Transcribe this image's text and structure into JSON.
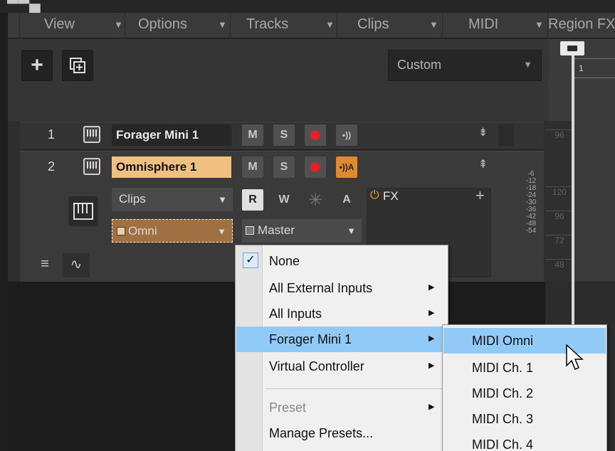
{
  "menubar": {
    "items": [
      {
        "label": "View"
      },
      {
        "label": "Options"
      },
      {
        "label": "Tracks"
      },
      {
        "label": "Clips"
      },
      {
        "label": "MIDI"
      },
      {
        "label": "Region FX"
      }
    ]
  },
  "toolbar": {
    "add_track_glyph": "+",
    "preset_select_value": "Custom"
  },
  "ruler": {
    "bar_number": "1"
  },
  "tracks": [
    {
      "number": "1",
      "name": "Forager Mini 1",
      "mute": "M",
      "solo": "S"
    },
    {
      "number": "2",
      "name": "Omnisphere 1",
      "mute": "M",
      "solo": "S",
      "clips_select": "Clips",
      "input_select": "Omni",
      "output_select": "Master",
      "read": "R",
      "write": "W",
      "arm_auto": "A",
      "fx_label": "FX",
      "meter_scale": [
        "-6",
        "-12",
        "-18",
        "-24",
        "-30",
        "-36",
        "-42",
        "-48",
        "-54"
      ]
    }
  ],
  "right_scale": [
    "96",
    "120",
    "96",
    "72",
    "48"
  ],
  "input_menu": {
    "items": [
      {
        "label": "None",
        "checked": true
      },
      {
        "label": "All External Inputs",
        "submenu": true
      },
      {
        "label": "All Inputs",
        "submenu": true
      },
      {
        "label": "Forager Mini 1",
        "submenu": true,
        "highlighted": true
      },
      {
        "label": "Virtual Controller",
        "submenu": true
      },
      {
        "label": "Preset",
        "submenu": true,
        "disabled": true
      },
      {
        "label": "Manage Presets..."
      }
    ]
  },
  "midi_submenu": {
    "items": [
      {
        "label": "MIDI Omni",
        "highlighted": true
      },
      {
        "label": "MIDI Ch. 1"
      },
      {
        "label": "MIDI Ch. 2"
      },
      {
        "label": "MIDI Ch. 3"
      },
      {
        "label": "MIDI Ch. 4"
      }
    ]
  },
  "colors": {
    "track_name_selected": "#f0c080",
    "input_select_bg": "#a07040",
    "menu_highlight": "#91c9f7",
    "record": "#e0202a"
  }
}
